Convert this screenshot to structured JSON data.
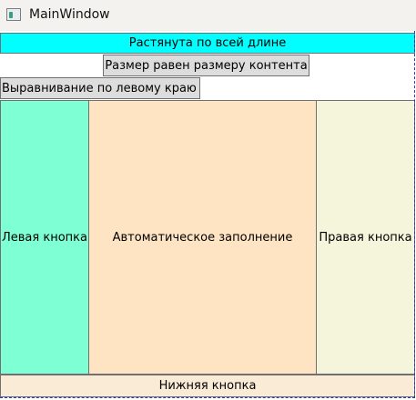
{
  "window": {
    "title": "MainWindow",
    "icon": "window-app-icon"
  },
  "buttons": {
    "stretch": "Растянута по всей длине",
    "content_size": "Размер равен размеру контента",
    "left_align": "Выравнивание по левому краю",
    "left": "Левая кнопка",
    "fill": "Автоматическое заполнение",
    "right": "Правая кнопка",
    "bottom": "Нижняя кнопка"
  },
  "colors": {
    "stretch_bg": "#00ffff",
    "content_size_bg": "#dddddd",
    "left_align_bg": "#dddddd",
    "left_bg": "#7fffd4",
    "fill_bg": "#ffe4c4",
    "right_bg": "#f5f5dc",
    "bottom_bg": "#faebd7"
  }
}
